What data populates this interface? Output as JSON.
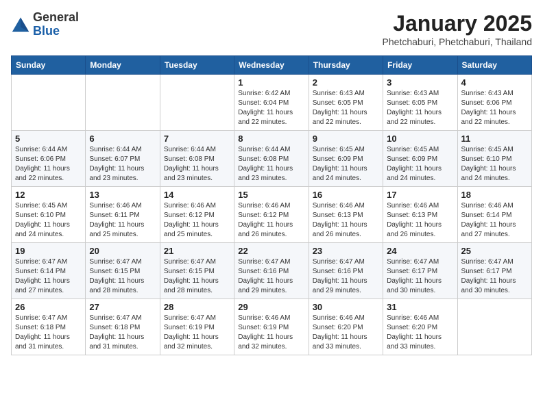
{
  "header": {
    "logo_general": "General",
    "logo_blue": "Blue",
    "month_title": "January 2025",
    "subtitle": "Phetchaburi, Phetchaburi, Thailand"
  },
  "weekdays": [
    "Sunday",
    "Monday",
    "Tuesday",
    "Wednesday",
    "Thursday",
    "Friday",
    "Saturday"
  ],
  "weeks": [
    [
      {
        "day": "",
        "info": ""
      },
      {
        "day": "",
        "info": ""
      },
      {
        "day": "",
        "info": ""
      },
      {
        "day": "1",
        "info": "Sunrise: 6:42 AM\nSunset: 6:04 PM\nDaylight: 11 hours\nand 22 minutes."
      },
      {
        "day": "2",
        "info": "Sunrise: 6:43 AM\nSunset: 6:05 PM\nDaylight: 11 hours\nand 22 minutes."
      },
      {
        "day": "3",
        "info": "Sunrise: 6:43 AM\nSunset: 6:05 PM\nDaylight: 11 hours\nand 22 minutes."
      },
      {
        "day": "4",
        "info": "Sunrise: 6:43 AM\nSunset: 6:06 PM\nDaylight: 11 hours\nand 22 minutes."
      }
    ],
    [
      {
        "day": "5",
        "info": "Sunrise: 6:44 AM\nSunset: 6:06 PM\nDaylight: 11 hours\nand 22 minutes."
      },
      {
        "day": "6",
        "info": "Sunrise: 6:44 AM\nSunset: 6:07 PM\nDaylight: 11 hours\nand 23 minutes."
      },
      {
        "day": "7",
        "info": "Sunrise: 6:44 AM\nSunset: 6:08 PM\nDaylight: 11 hours\nand 23 minutes."
      },
      {
        "day": "8",
        "info": "Sunrise: 6:44 AM\nSunset: 6:08 PM\nDaylight: 11 hours\nand 23 minutes."
      },
      {
        "day": "9",
        "info": "Sunrise: 6:45 AM\nSunset: 6:09 PM\nDaylight: 11 hours\nand 24 minutes."
      },
      {
        "day": "10",
        "info": "Sunrise: 6:45 AM\nSunset: 6:09 PM\nDaylight: 11 hours\nand 24 minutes."
      },
      {
        "day": "11",
        "info": "Sunrise: 6:45 AM\nSunset: 6:10 PM\nDaylight: 11 hours\nand 24 minutes."
      }
    ],
    [
      {
        "day": "12",
        "info": "Sunrise: 6:45 AM\nSunset: 6:10 PM\nDaylight: 11 hours\nand 24 minutes."
      },
      {
        "day": "13",
        "info": "Sunrise: 6:46 AM\nSunset: 6:11 PM\nDaylight: 11 hours\nand 25 minutes."
      },
      {
        "day": "14",
        "info": "Sunrise: 6:46 AM\nSunset: 6:12 PM\nDaylight: 11 hours\nand 25 minutes."
      },
      {
        "day": "15",
        "info": "Sunrise: 6:46 AM\nSunset: 6:12 PM\nDaylight: 11 hours\nand 26 minutes."
      },
      {
        "day": "16",
        "info": "Sunrise: 6:46 AM\nSunset: 6:13 PM\nDaylight: 11 hours\nand 26 minutes."
      },
      {
        "day": "17",
        "info": "Sunrise: 6:46 AM\nSunset: 6:13 PM\nDaylight: 11 hours\nand 26 minutes."
      },
      {
        "day": "18",
        "info": "Sunrise: 6:46 AM\nSunset: 6:14 PM\nDaylight: 11 hours\nand 27 minutes."
      }
    ],
    [
      {
        "day": "19",
        "info": "Sunrise: 6:47 AM\nSunset: 6:14 PM\nDaylight: 11 hours\nand 27 minutes."
      },
      {
        "day": "20",
        "info": "Sunrise: 6:47 AM\nSunset: 6:15 PM\nDaylight: 11 hours\nand 28 minutes."
      },
      {
        "day": "21",
        "info": "Sunrise: 6:47 AM\nSunset: 6:15 PM\nDaylight: 11 hours\nand 28 minutes."
      },
      {
        "day": "22",
        "info": "Sunrise: 6:47 AM\nSunset: 6:16 PM\nDaylight: 11 hours\nand 29 minutes."
      },
      {
        "day": "23",
        "info": "Sunrise: 6:47 AM\nSunset: 6:16 PM\nDaylight: 11 hours\nand 29 minutes."
      },
      {
        "day": "24",
        "info": "Sunrise: 6:47 AM\nSunset: 6:17 PM\nDaylight: 11 hours\nand 30 minutes."
      },
      {
        "day": "25",
        "info": "Sunrise: 6:47 AM\nSunset: 6:17 PM\nDaylight: 11 hours\nand 30 minutes."
      }
    ],
    [
      {
        "day": "26",
        "info": "Sunrise: 6:47 AM\nSunset: 6:18 PM\nDaylight: 11 hours\nand 31 minutes."
      },
      {
        "day": "27",
        "info": "Sunrise: 6:47 AM\nSunset: 6:18 PM\nDaylight: 11 hours\nand 31 minutes."
      },
      {
        "day": "28",
        "info": "Sunrise: 6:47 AM\nSunset: 6:19 PM\nDaylight: 11 hours\nand 32 minutes."
      },
      {
        "day": "29",
        "info": "Sunrise: 6:46 AM\nSunset: 6:19 PM\nDaylight: 11 hours\nand 32 minutes."
      },
      {
        "day": "30",
        "info": "Sunrise: 6:46 AM\nSunset: 6:20 PM\nDaylight: 11 hours\nand 33 minutes."
      },
      {
        "day": "31",
        "info": "Sunrise: 6:46 AM\nSunset: 6:20 PM\nDaylight: 11 hours\nand 33 minutes."
      },
      {
        "day": "",
        "info": ""
      }
    ]
  ]
}
